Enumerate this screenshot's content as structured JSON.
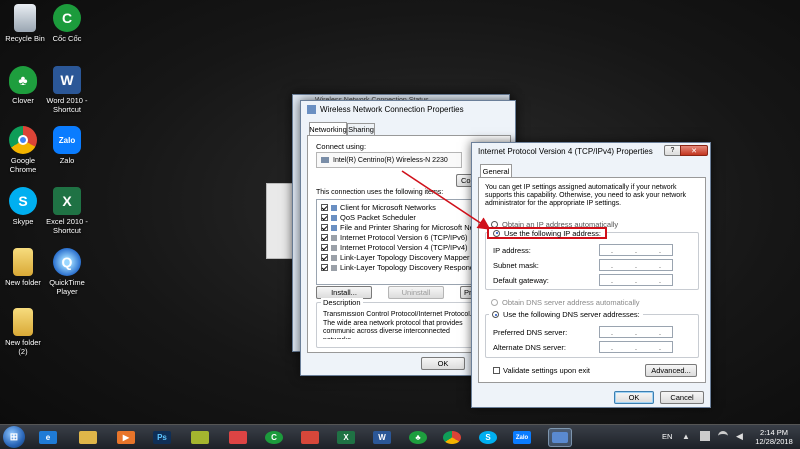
{
  "desktop": {
    "icons": [
      {
        "label": "Recycle Bin"
      },
      {
        "label": "Cốc Cốc"
      },
      {
        "label": "Clover"
      },
      {
        "label": "Word 2010 -\nShortcut"
      },
      {
        "label": "Google\nChrome"
      },
      {
        "label": "Zalo"
      },
      {
        "label": "Skype"
      },
      {
        "label": "Excel 2010 -\nShortcut"
      },
      {
        "label": "New folder"
      },
      {
        "label": "QuickTime\nPlayer"
      },
      {
        "label": "New folder\n(2)"
      }
    ]
  },
  "bg_window": {
    "title": "Wireless Network Connection Status"
  },
  "wnc_props": {
    "title": "Wireless Network Connection Properties",
    "tabs": [
      "Networking",
      "Sharing"
    ],
    "connect_using_label": "Connect using:",
    "adapter": "Intel(R) Centrino(R) Wireless-N 2230",
    "configure_partial": "Co",
    "items_label": "This connection uses the following items:",
    "items": [
      "Client for Microsoft Networks",
      "QoS Packet Scheduler",
      "File and Printer Sharing for Microsoft Networks",
      "Internet Protocol Version 6 (TCP/IPv6)",
      "Internet Protocol Version 4 (TCP/IPv4)",
      "Link-Layer Topology Discovery Mapper I/O Dri",
      "Link-Layer Topology Discovery Responder"
    ],
    "install_label": "Install...",
    "uninstall_label": "Uninstall",
    "properties_partial": "Pr",
    "description_label": "Description",
    "description_text": "Transmission Control Protocol/Internet Protocol. The wide area network protocol that provides communic across diverse interconnected networks.",
    "ok_label": "OK"
  },
  "ipv4": {
    "title": "Internet Protocol Version 4 (TCP/IPv4) Properties",
    "tab": "General",
    "intro": "You can get IP settings assigned automatically if your network supports this capability. Otherwise, you need to ask your network administrator for the appropriate IP settings.",
    "auto_ip": "Obtain an IP address automatically",
    "use_ip": "Use the following IP address:",
    "ip_label": "IP address:",
    "mask_label": "Subnet mask:",
    "gateway_label": "Default gateway:",
    "auto_dns": "Obtain DNS server address automatically",
    "use_dns": "Use the following DNS server addresses:",
    "pref_dns_label": "Preferred DNS server:",
    "alt_dns_label": "Alternate DNS server:",
    "validate_label": "Validate settings upon exit",
    "advanced_label": "Advanced...",
    "ok_label": "OK",
    "cancel_label": "Cancel",
    "help_glyph": "?",
    "close_glyph": "✕"
  },
  "taskbar": {
    "lang": "EN",
    "time": "2:14 PM",
    "date": "12/28/2018",
    "zalo_label": "Zalo"
  },
  "colors": {
    "highlight": "#d0101a",
    "arrow": "#d0101a",
    "taskbar": "#22262d"
  }
}
